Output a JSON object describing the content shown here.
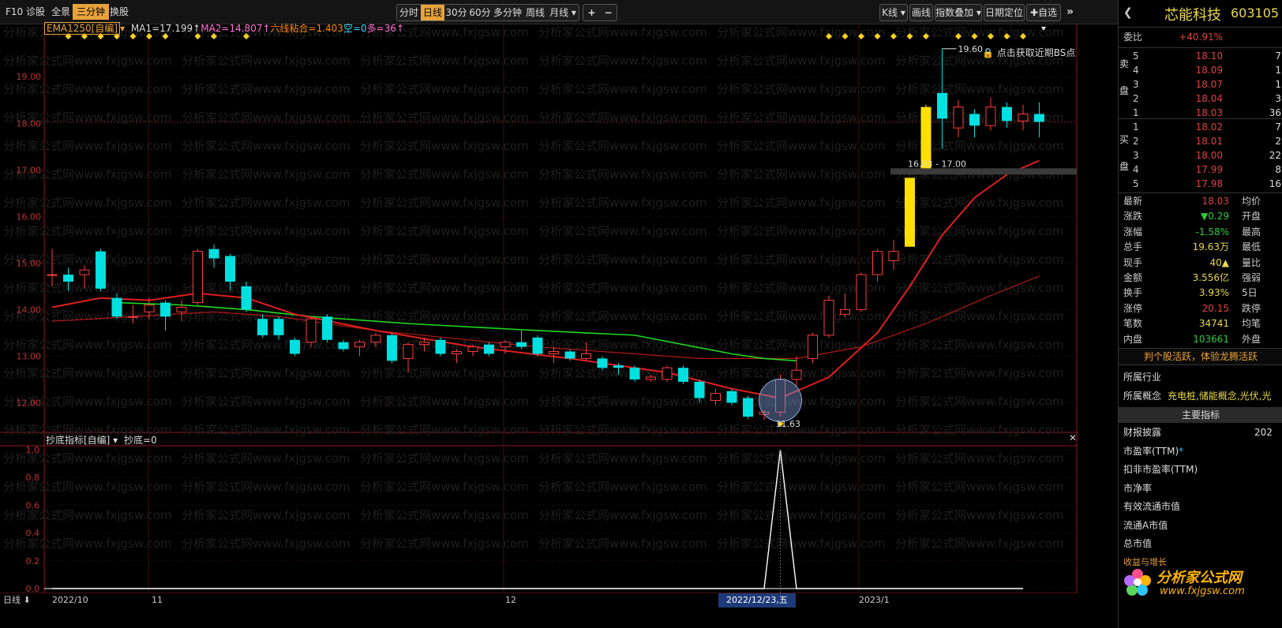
{
  "toolbar": {
    "left": [
      "F10",
      "诊股",
      "全景",
      "三分钟",
      "换股"
    ],
    "active_left": "三分钟",
    "periods": [
      "分时",
      "日线",
      "30分",
      "60分",
      "多分钟",
      "周线",
      "月线 ▾"
    ],
    "active_period": "日线",
    "zoom": [
      "+",
      "−"
    ],
    "right": [
      "K线 ▾",
      "画线",
      "指数叠加 ▾",
      "日期定位",
      "✚自选 ▾"
    ],
    "close_glyph": "»"
  },
  "indicator_top": {
    "name": "EMA1250[自编]",
    "ma1": "MA1=17.199↑",
    "ma2": "MA2=14.807↑",
    "six": "六线粘合=1.403",
    "kong": "空=0",
    "duo": "多=36↑"
  },
  "yaxis_top": [
    "19.00",
    "18.00",
    "17.00",
    "16.00",
    "15.00",
    "14.00",
    "13.00",
    "12.00"
  ],
  "yaxis_bottom": [
    "1.0",
    "0.8",
    "0.6",
    "0.4",
    "0.2",
    "0.0"
  ],
  "annotations": {
    "high_label": "19.60",
    "low_label": "11.63",
    "gap_label": "16.83 - 17.00",
    "bs_hint": "点击获取近期BS点"
  },
  "indicator_bottom": {
    "name": "抄底指标[自编] ▾",
    "value": "抄底=0"
  },
  "xaxis": {
    "mode": "日线 ⬇",
    "labels": [
      "2022/10",
      "11",
      "12",
      "2023/1"
    ],
    "cursor_date": "2022/12/23,五"
  },
  "watermark": {
    "text": "分析家公式网www.fxjgsw.com",
    "logo_cn": "分析家公式网",
    "logo_url": "www.fxjgsw.com"
  },
  "stock": {
    "name": "芯能科技",
    "code": "603105"
  },
  "weibi": {
    "label": "委比",
    "value": "+40.91%"
  },
  "sell_side": "卖盘",
  "buy_side": "买盘",
  "asks": [
    {
      "lvl": "5",
      "price": "18.10",
      "vol": "7"
    },
    {
      "lvl": "4",
      "price": "18.09",
      "vol": "1"
    },
    {
      "lvl": "3",
      "price": "18.07",
      "vol": "1"
    },
    {
      "lvl": "2",
      "price": "18.04",
      "vol": "3"
    },
    {
      "lvl": "1",
      "price": "18.03",
      "vol": "36"
    }
  ],
  "bids": [
    {
      "lvl": "1",
      "price": "18.02",
      "vol": "7"
    },
    {
      "lvl": "2",
      "price": "18.01",
      "vol": "2"
    },
    {
      "lvl": "3",
      "price": "18.00",
      "vol": "22"
    },
    {
      "lvl": "4",
      "price": "17.99",
      "vol": "8"
    },
    {
      "lvl": "5",
      "price": "17.98",
      "vol": "16"
    }
  ],
  "quote": [
    {
      "l": "最新",
      "v": "18.03",
      "c": "#e04040",
      "r": "均价"
    },
    {
      "l": "涨跌",
      "v": "▼0.29",
      "c": "#2ecc40",
      "r": "开盘"
    },
    {
      "l": "涨幅",
      "v": "-1.58%",
      "c": "#2ecc40",
      "r": "最高"
    },
    {
      "l": "总手",
      "v": "19.63万",
      "c": "#e8d84a",
      "r": "最低"
    },
    {
      "l": "现手",
      "v": "40▲",
      "c": "#e8d84a",
      "r": "量比"
    },
    {
      "l": "金额",
      "v": "3.556亿",
      "c": "#e8d84a",
      "r": "强弱"
    },
    {
      "l": "换手",
      "v": "3.93%",
      "c": "#e8d84a",
      "r": "5日"
    },
    {
      "l": "涨停",
      "v": "20.15",
      "c": "#e04040",
      "r": "跌停"
    },
    {
      "l": "笔数",
      "v": "34741",
      "c": "#e8d84a",
      "r": "均笔"
    },
    {
      "l": "内盘",
      "v": "103661",
      "c": "#2ecc40",
      "r": "外盘"
    }
  ],
  "promo": "判个股活跃，体验龙腾活跃",
  "industry": {
    "label": "所属行业"
  },
  "concept": {
    "label": "所属概念",
    "value": "充电桩,储能概念,光伏,光"
  },
  "main_index": "主要指标",
  "fin": [
    {
      "l": "财报披露",
      "v": "202"
    },
    {
      "l": "市盈率(TTM)",
      "star": "*"
    },
    {
      "l": "扣非市盈率(TTM)"
    },
    {
      "l": "市净率"
    },
    {
      "l": "有效流通市值"
    },
    {
      "l": "流通A市值"
    },
    {
      "l": "总市值"
    },
    {
      "l": "收益与增长"
    }
  ],
  "colors": {
    "up": "#ff3c3c",
    "down": "#00e0e0",
    "limit": "#ffe000",
    "ma_red": "#e01e1e",
    "ma_green": "#22d822",
    "accent": "#e8a23b",
    "diamond": "#ffd21e"
  },
  "chart_data": {
    "type": "candlestick",
    "ylim": [
      11.5,
      19.8
    ],
    "candles": [
      {
        "o": 14.75,
        "c": 14.75,
        "h": 15.3,
        "l": 14.5
      },
      {
        "o": 14.75,
        "c": 14.6,
        "h": 14.9,
        "l": 14.4
      },
      {
        "o": 14.75,
        "c": 14.85,
        "h": 14.95,
        "l": 14.45
      },
      {
        "o": 15.25,
        "c": 14.45,
        "h": 15.3,
        "l": 14.4
      },
      {
        "o": 14.25,
        "c": 13.85,
        "h": 14.35,
        "l": 13.8
      },
      {
        "o": 13.85,
        "c": 13.85,
        "h": 14.1,
        "l": 13.7
      },
      {
        "o": 13.95,
        "c": 14.1,
        "h": 14.25,
        "l": 13.8
      },
      {
        "o": 14.15,
        "c": 13.85,
        "h": 14.2,
        "l": 13.55
      },
      {
        "o": 13.95,
        "c": 14.05,
        "h": 14.2,
        "l": 13.75
      },
      {
        "o": 14.15,
        "c": 15.25,
        "h": 15.3,
        "l": 14.1
      },
      {
        "o": 15.3,
        "c": 15.1,
        "h": 15.4,
        "l": 14.9
      },
      {
        "o": 15.15,
        "c": 14.6,
        "h": 15.2,
        "l": 14.4
      },
      {
        "o": 14.5,
        "c": 14.0,
        "h": 14.6,
        "l": 13.95
      },
      {
        "o": 13.8,
        "c": 13.45,
        "h": 13.9,
        "l": 13.4
      },
      {
        "o": 13.8,
        "c": 13.45,
        "h": 13.85,
        "l": 13.35
      },
      {
        "o": 13.35,
        "c": 13.05,
        "h": 13.4,
        "l": 13.0
      },
      {
        "o": 13.3,
        "c": 13.8,
        "h": 13.85,
        "l": 13.2
      },
      {
        "o": 13.85,
        "c": 13.35,
        "h": 13.9,
        "l": 13.3
      },
      {
        "o": 13.3,
        "c": 13.15,
        "h": 13.35,
        "l": 13.1
      },
      {
        "o": 13.2,
        "c": 13.3,
        "h": 13.35,
        "l": 13.0
      },
      {
        "o": 13.3,
        "c": 13.45,
        "h": 13.5,
        "l": 13.2
      },
      {
        "o": 13.45,
        "c": 12.9,
        "h": 13.5,
        "l": 12.85
      },
      {
        "o": 12.95,
        "c": 13.25,
        "h": 13.3,
        "l": 12.65
      },
      {
        "o": 13.25,
        "c": 13.3,
        "h": 13.4,
        "l": 13.1
      },
      {
        "o": 13.35,
        "c": 13.05,
        "h": 13.4,
        "l": 13.0
      },
      {
        "o": 13.05,
        "c": 13.1,
        "h": 13.15,
        "l": 12.85
      },
      {
        "o": 13.1,
        "c": 13.2,
        "h": 13.25,
        "l": 13.0
      },
      {
        "o": 13.25,
        "c": 13.05,
        "h": 13.3,
        "l": 13.0
      },
      {
        "o": 13.2,
        "c": 13.3,
        "h": 13.35,
        "l": 13.05
      },
      {
        "o": 13.3,
        "c": 13.2,
        "h": 13.55,
        "l": 13.15
      },
      {
        "o": 13.4,
        "c": 13.05,
        "h": 13.45,
        "l": 13.0
      },
      {
        "o": 13.05,
        "c": 13.1,
        "h": 13.2,
        "l": 12.85
      },
      {
        "o": 13.1,
        "c": 12.95,
        "h": 13.15,
        "l": 12.9
      },
      {
        "o": 12.95,
        "c": 13.05,
        "h": 13.3,
        "l": 12.9
      },
      {
        "o": 12.95,
        "c": 12.75,
        "h": 13.0,
        "l": 12.7
      },
      {
        "o": 12.8,
        "c": 12.75,
        "h": 12.85,
        "l": 12.6
      },
      {
        "o": 12.75,
        "c": 12.5,
        "h": 12.8,
        "l": 12.45
      },
      {
        "o": 12.5,
        "c": 12.55,
        "h": 12.6,
        "l": 12.45
      },
      {
        "o": 12.5,
        "c": 12.75,
        "h": 12.8,
        "l": 12.45
      },
      {
        "o": 12.75,
        "c": 12.45,
        "h": 12.8,
        "l": 12.4
      },
      {
        "o": 12.45,
        "c": 12.1,
        "h": 12.5,
        "l": 12.0
      },
      {
        "o": 12.05,
        "c": 12.2,
        "h": 12.3,
        "l": 11.95
      },
      {
        "o": 12.25,
        "c": 12.0,
        "h": 12.3,
        "l": 11.95
      },
      {
        "o": 12.1,
        "c": 11.7,
        "h": 12.15,
        "l": 11.65
      },
      {
        "o": 11.75,
        "c": 11.8,
        "h": 11.85,
        "l": 11.63
      },
      {
        "o": 11.8,
        "c": 12.5,
        "h": 12.6,
        "l": 11.7
      },
      {
        "o": 12.5,
        "c": 12.7,
        "h": 13.0,
        "l": 12.35
      },
      {
        "o": 12.95,
        "c": 13.45,
        "h": 13.5,
        "l": 12.85
      },
      {
        "o": 13.45,
        "c": 14.2,
        "h": 14.3,
        "l": 13.4
      },
      {
        "o": 13.9,
        "c": 14.0,
        "h": 14.35,
        "l": 13.85
      },
      {
        "o": 14.0,
        "c": 14.75,
        "h": 14.8,
        "l": 13.95
      },
      {
        "o": 14.75,
        "c": 15.25,
        "h": 15.3,
        "l": 14.6
      },
      {
        "o": 15.05,
        "c": 15.25,
        "h": 15.5,
        "l": 14.85
      },
      {
        "o": 15.35,
        "c": 16.83,
        "h": 16.83,
        "l": 15.35,
        "limit": true
      },
      {
        "o": 17.0,
        "c": 18.35,
        "h": 18.4,
        "l": 17.0,
        "limit": true
      },
      {
        "o": 18.65,
        "c": 18.1,
        "h": 19.6,
        "l": 17.45
      },
      {
        "o": 17.9,
        "c": 18.35,
        "h": 18.5,
        "l": 17.7
      },
      {
        "o": 18.2,
        "c": 17.95,
        "h": 18.3,
        "l": 17.7
      },
      {
        "o": 17.95,
        "c": 18.35,
        "h": 18.55,
        "l": 17.85
      },
      {
        "o": 18.35,
        "c": 18.05,
        "h": 18.45,
        "l": 17.9
      },
      {
        "o": 18.05,
        "c": 18.2,
        "h": 18.4,
        "l": 17.85
      },
      {
        "o": 18.2,
        "c": 18.03,
        "h": 18.45,
        "l": 17.7
      }
    ],
    "ma_red_fast": [
      [
        0,
        14.05
      ],
      [
        3,
        14.25
      ],
      [
        6,
        14.2
      ],
      [
        9,
        14.35
      ],
      [
        12,
        14.25
      ],
      [
        15,
        13.9
      ],
      [
        20,
        13.55
      ],
      [
        26,
        13.2
      ],
      [
        32,
        12.95
      ],
      [
        38,
        12.65
      ],
      [
        42,
        12.3
      ],
      [
        45,
        12.1
      ],
      [
        48,
        12.55
      ],
      [
        51,
        13.5
      ],
      [
        53,
        14.5
      ],
      [
        55,
        15.6
      ],
      [
        57,
        16.4
      ],
      [
        59,
        16.9
      ],
      [
        61,
        17.2
      ]
    ],
    "ma_red_slow": [
      [
        0,
        13.75
      ],
      [
        5,
        13.85
      ],
      [
        10,
        13.95
      ],
      [
        14,
        13.85
      ],
      [
        20,
        13.55
      ],
      [
        30,
        13.2
      ],
      [
        40,
        12.95
      ],
      [
        46,
        12.95
      ],
      [
        50,
        13.2
      ],
      [
        54,
        13.7
      ],
      [
        58,
        14.3
      ],
      [
        61,
        14.72
      ]
    ],
    "ma_green": [
      [
        4,
        14.15
      ],
      [
        8,
        14.1
      ],
      [
        12,
        14.0
      ],
      [
        16,
        13.85
      ],
      [
        22,
        13.7
      ],
      [
        30,
        13.55
      ],
      [
        36,
        13.45
      ],
      [
        42,
        13.05
      ],
      [
        44,
        12.95
      ],
      [
        46,
        12.9
      ]
    ],
    "signal": [
      [
        0,
        0
      ],
      [
        44,
        0
      ],
      [
        45,
        1.0
      ],
      [
        46,
        0
      ],
      [
        60,
        0
      ]
    ],
    "diamonds_top": [
      1,
      2,
      3,
      4,
      5,
      6,
      7,
      9,
      10,
      12,
      48,
      49,
      50,
      51,
      52,
      53,
      54,
      56,
      57,
      58,
      59,
      60
    ],
    "circle_index": 45
  }
}
